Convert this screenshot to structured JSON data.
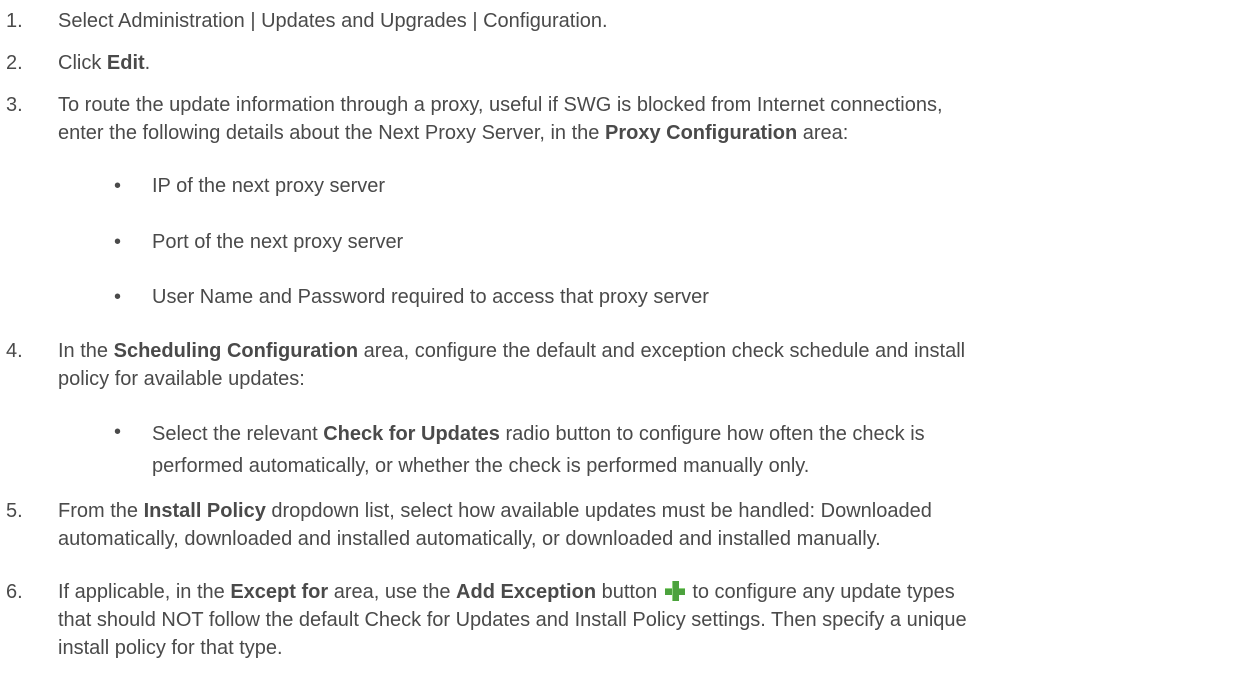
{
  "steps": [
    {
      "number": "1.",
      "text": "Select Administration | Updates and Upgrades | Configuration."
    },
    {
      "number": "2.",
      "pre": "Click ",
      "bold": "Edit",
      "post": "."
    },
    {
      "number": "3.",
      "line1": "To route the update information through a proxy, useful if SWG is blocked from Internet connections,",
      "line2_pre": "enter the following details about the Next Proxy Server, in the ",
      "line2_bold": "Proxy Configuration",
      "line2_post": " area:"
    },
    {
      "number": "4.",
      "pre": "In the ",
      "bold": "Scheduling Configuration",
      "line1_post": " area, configure the default and exception check schedule and install",
      "line2": "policy for available updates:"
    },
    {
      "number": "5.",
      "pre": "From the ",
      "bold": "Install Policy",
      "line1_post": " dropdown list, select how available updates must be handled: Downloaded",
      "line2": "automatically, downloaded and installed automatically, or downloaded and installed manually."
    },
    {
      "number": "6.",
      "pre": "If applicable, in the ",
      "bold1": "Except for",
      "mid": " area, use the ",
      "bold2": "Add Exception",
      "post_icon": " button ",
      "after_icon": " to configure any update types",
      "line2": "that should NOT follow the default Check for Updates and Install Policy settings. Then specify a unique",
      "line3": "install policy for that type."
    }
  ],
  "proxy_bullets": [
    "IP of the next proxy server",
    "Port of the next proxy server",
    "User Name and Password required to access that proxy server"
  ],
  "schedule_bullet": {
    "pre": "Select the relevant ",
    "bold": "Check for Updates",
    "line1_post": " radio button to configure how often the check is",
    "line2": "performed automatically, or whether the check is performed manually only."
  },
  "bullet_char": "•",
  "icons": {
    "add_exception": "plus-icon"
  },
  "colors": {
    "text": "#4a4a4a",
    "icon_green": "#4ca23d"
  }
}
